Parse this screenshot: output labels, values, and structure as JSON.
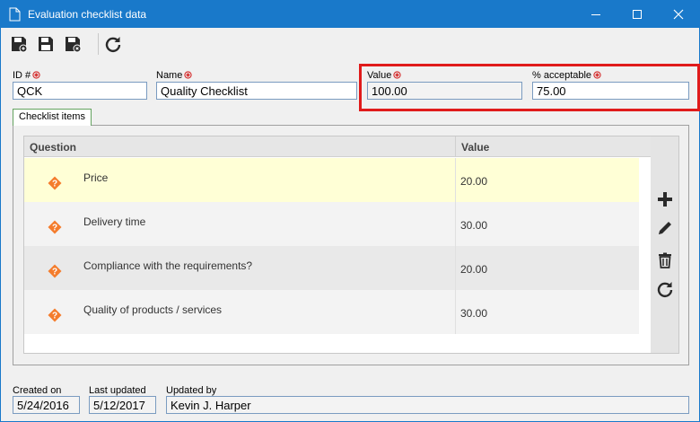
{
  "window": {
    "title": "Evaluation checklist data",
    "icons": [
      "document-icon",
      "minimize-icon",
      "maximize-icon",
      "close-icon"
    ]
  },
  "toolbar": {
    "buttons": [
      "save-new-icon",
      "save-icon",
      "save-close-icon",
      "refresh-icon"
    ]
  },
  "form": {
    "id_label": "ID #",
    "id_value": "QCK",
    "name_label": "Name",
    "name_value": "Quality Checklist",
    "value_label": "Value",
    "value_value": "100.00",
    "acceptable_label": "% acceptable",
    "acceptable_value": "75.00"
  },
  "tab": {
    "label": "Checklist items"
  },
  "grid": {
    "columns": {
      "question": "Question",
      "value": "Value"
    },
    "rows": [
      {
        "question": "Price",
        "value": "20.00",
        "icon": "question-diamond-icon",
        "bg": "#ffffd6"
      },
      {
        "question": "Delivery time",
        "value": "30.00",
        "icon": "question-diamond-icon",
        "bg": "#f3f3f3"
      },
      {
        "question": "Compliance with the requirements?",
        "value": "20.00",
        "icon": "question-diamond-icon",
        "bg": "#e9e9e9"
      },
      {
        "question": "Quality of products / services",
        "value": "30.00",
        "icon": "question-diamond-icon",
        "bg": "#f3f3f3"
      }
    ],
    "side_tools": [
      "add-icon",
      "edit-icon",
      "delete-icon",
      "refresh-icon"
    ]
  },
  "footer": {
    "created_label": "Created on",
    "created_value": "5/24/2016",
    "updated_label": "Last updated",
    "updated_value": "5/12/2017",
    "updated_by_label": "Updated by",
    "updated_by_value": "Kevin J. Harper"
  },
  "colors": {
    "titlebar": "#1979ca",
    "highlight": "#e01b1b",
    "required": "#d42a2a",
    "question_icon": "#f47c2c"
  }
}
